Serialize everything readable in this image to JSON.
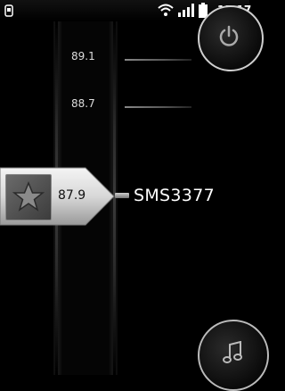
{
  "status_bar": {
    "time": "15:17",
    "icons": [
      "notification-icon",
      "wifi-icon",
      "signal-icon",
      "battery-icon"
    ]
  },
  "tuner": {
    "frequencies": [
      "89.1",
      "88.7"
    ],
    "current_frequency": "87.9",
    "station_name": "SMS3377"
  },
  "controls": {
    "power_icon": "power-icon",
    "music_icon": "music-note-icon",
    "favorite_icon": "star-icon"
  }
}
